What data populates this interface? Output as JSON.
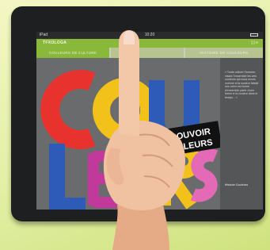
{
  "statusbar": {
    "time": "10:20",
    "signal": "iPad"
  },
  "appbar": {
    "logo": "TFXOLOGA",
    "url": "",
    "icons": "[ ] ≡"
  },
  "tabs": [
    "Couleurs de culture",
    "",
    "Histoire de couleurs"
  ],
  "artwork": {
    "big_letters": [
      "C",
      "O",
      "U",
      "L",
      "E",
      "U",
      "R",
      "S"
    ],
    "letter_colors": [
      "#e8322e",
      "#f2c21a",
      "#2f5bb8",
      "#2f5bb8",
      "#c13a9b",
      "#7e4fc2",
      "#f2c21a",
      "#e46ab8"
    ],
    "banner_line1": "POUVOIR",
    "banner_line2": "ULEURS"
  },
  "sidebar": {
    "paragraph": "« Toute culture l'homme, visant l'ensemble les arts couleurs qui nous avons comme si la couleur faisait nos créer est forme d'ensemble partir d'une forme à la couleur dans le temps... »",
    "footer": "Histoire Couleurs"
  },
  "colors": {
    "tablet_bezel": "#1e1f21",
    "brand_green": "#8ab83a",
    "screen_bg": "#6a6b6d",
    "skin": "#f1c2a2"
  }
}
